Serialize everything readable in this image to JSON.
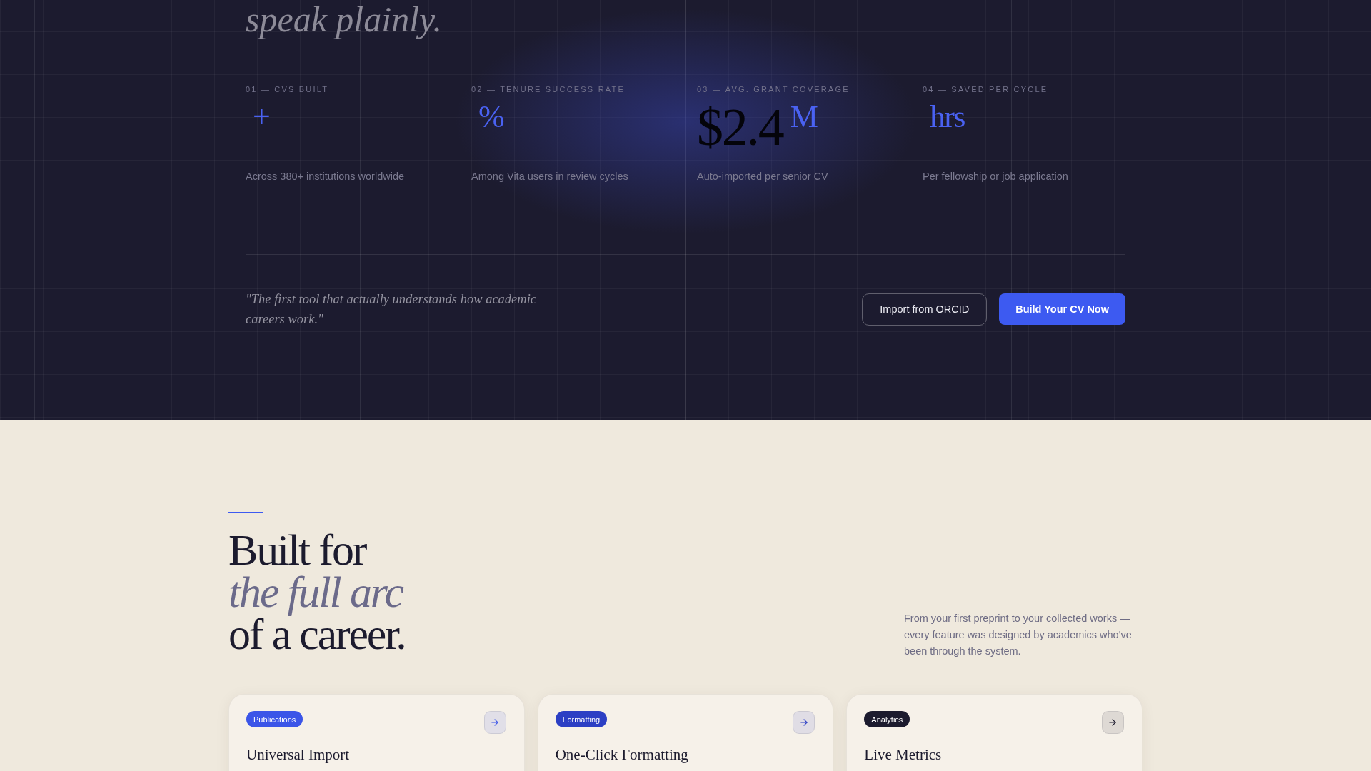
{
  "hero": {
    "heading_tail": "speak plainly."
  },
  "stats": [
    {
      "label": "01 — CVS BUILT",
      "suffix": "+",
      "caption": "Across 380+ institutions worldwide"
    },
    {
      "label": "02 — TENURE SUCCESS RATE",
      "suffix": "%",
      "caption": "Among Vita users in review cycles"
    },
    {
      "label": "03 — AVG. GRANT COVERAGE",
      "value": "$2.4",
      "suffix": "M",
      "caption": "Auto-imported per senior CV"
    },
    {
      "label": "04 — SAVED PER CYCLE",
      "suffix": "hrs",
      "caption": "Per fellowship or job application"
    }
  ],
  "cta": {
    "quote": "\"The first tool that actually understands how academic careers work.\"",
    "buttons": [
      {
        "label": "Import from ORCID",
        "kind": "outline"
      },
      {
        "label": "Build Your CV Now",
        "kind": "primary"
      }
    ]
  },
  "features": {
    "heading": "Built for *the full arc* of a career.",
    "intro": "From your first preprint to your collected works — every feature was designed by academics who've been through the system.",
    "cards": [
      {
        "tag": "Publications",
        "color": "#3b55e8",
        "title": "Universal Import"
      },
      {
        "tag": "Formatting",
        "color": "#2c3fc4",
        "title": "One-Click Formatting"
      },
      {
        "tag": "Analytics",
        "color": "#1c1b2e",
        "title": "Live Metrics"
      }
    ]
  }
}
